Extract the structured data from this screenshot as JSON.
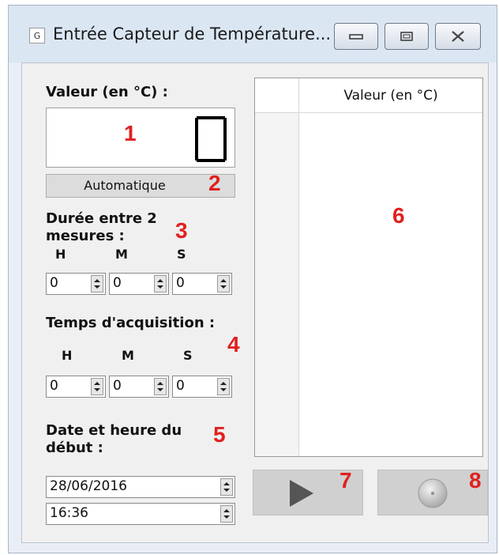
{
  "window": {
    "title": "Entrée Capteur de Température...",
    "icon_letter": "G"
  },
  "value_section": {
    "label": "Valeur (en °C) :",
    "lcd_value": "0",
    "auto_button": "Automatique"
  },
  "interval_section": {
    "label_line1": "Durée entre 2",
    "label_line2": "mesures :",
    "h_label": "H",
    "m_label": "M",
    "s_label": "S",
    "h": "0",
    "m": "0",
    "s": "0"
  },
  "acquisition_section": {
    "label": "Temps d'acquisition :",
    "h_label": "H",
    "m_label": "M",
    "s_label": "S",
    "h": "0",
    "m": "0",
    "s": "0"
  },
  "start_section": {
    "label_line1": "Date et heure du",
    "label_line2": "début :",
    "date": "28/06/2016",
    "time": "16:36"
  },
  "table": {
    "column_header": "Valeur (en °C)"
  },
  "annotations": [
    "1",
    "2",
    "3",
    "4",
    "5",
    "6",
    "7",
    "8"
  ],
  "icons": {
    "play": "play-icon",
    "record": "record-icon",
    "minimize": "minimize-icon",
    "maximize": "maximize-icon",
    "close": "close-icon"
  },
  "colors": {
    "annotation": "#e02020",
    "play_triangle": "#555555",
    "button_face": "#d0d0d0"
  }
}
